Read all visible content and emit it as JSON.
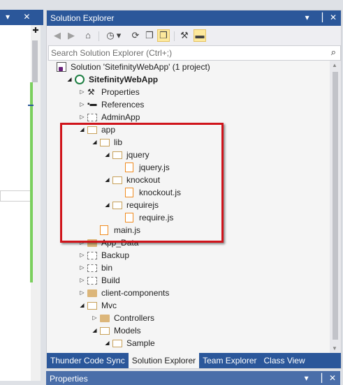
{
  "left_panel": {
    "title_glyphs": "▾ ✕",
    "pin_glyph": "✚"
  },
  "solution_explorer": {
    "title": "Solution Explorer",
    "title_buttons": {
      "dropdown": "▾",
      "pin": "▕",
      "close": "✕"
    },
    "toolbar": {
      "back": "◀",
      "forward": "▶",
      "home": "⌂",
      "history": "◷",
      "history_dropdown": "▾",
      "sync": "⟳",
      "collapse": "❐",
      "show_all": "❒",
      "properties": "⚒",
      "preview": "▬"
    },
    "search_placeholder": "Search Solution Explorer (Ctrl+;)",
    "search_icon": "⌕",
    "tree": [
      {
        "label": "Solution 'SitefinityWebApp' (1 project)",
        "depth": 0,
        "icon": "solution-icon",
        "arrow": ""
      },
      {
        "label": "SitefinityWebApp",
        "depth": 1,
        "icon": "web-project-icon",
        "arrow": "◢",
        "bold": true
      },
      {
        "label": "Properties",
        "depth": 2,
        "icon": "wrench-icon",
        "arrow": "▷"
      },
      {
        "label": "References",
        "depth": 2,
        "icon": "references-icon",
        "arrow": "▷"
      },
      {
        "label": "AdminApp",
        "depth": 2,
        "icon": "folder-dashed-icon",
        "arrow": "▷"
      },
      {
        "label": "app",
        "depth": 2,
        "icon": "folder-open-icon",
        "arrow": "◢"
      },
      {
        "label": "lib",
        "depth": 3,
        "icon": "folder-open-icon",
        "arrow": "◢"
      },
      {
        "label": "jquery",
        "depth": 4,
        "icon": "folder-open-icon",
        "arrow": "◢"
      },
      {
        "label": "jquery.js",
        "depth": 5,
        "icon": "js-file-icon",
        "arrow": ""
      },
      {
        "label": "knockout",
        "depth": 4,
        "icon": "folder-open-icon",
        "arrow": "◢"
      },
      {
        "label": "knockout.js",
        "depth": 5,
        "icon": "js-file-icon",
        "arrow": ""
      },
      {
        "label": "requirejs",
        "depth": 4,
        "icon": "folder-open-icon",
        "arrow": "◢"
      },
      {
        "label": "require.js",
        "depth": 5,
        "icon": "js-file-icon",
        "arrow": ""
      },
      {
        "label": "main.js",
        "depth": 3,
        "icon": "js-file-icon",
        "arrow": ""
      },
      {
        "label": "App_Data",
        "depth": 2,
        "icon": "folder-icon",
        "arrow": "▷"
      },
      {
        "label": "Backup",
        "depth": 2,
        "icon": "folder-dashed-icon",
        "arrow": "▷"
      },
      {
        "label": "bin",
        "depth": 2,
        "icon": "folder-dashed-icon",
        "arrow": "▷"
      },
      {
        "label": "Build",
        "depth": 2,
        "icon": "folder-dashed-icon",
        "arrow": "▷"
      },
      {
        "label": "client-components",
        "depth": 2,
        "icon": "folder-icon",
        "arrow": "▷"
      },
      {
        "label": "Mvc",
        "depth": 2,
        "icon": "folder-open-icon",
        "arrow": "◢"
      },
      {
        "label": "Controllers",
        "depth": 3,
        "icon": "folder-icon",
        "arrow": "▷"
      },
      {
        "label": "Models",
        "depth": 3,
        "icon": "folder-open-icon",
        "arrow": "◢"
      },
      {
        "label": "Sample",
        "depth": 4,
        "icon": "folder-open-icon",
        "arrow": "◢"
      }
    ],
    "tabs": [
      {
        "label": "Thunder Code Sync",
        "selected": false
      },
      {
        "label": "Solution Explorer",
        "selected": true
      },
      {
        "label": "Team Explorer",
        "selected": false
      },
      {
        "label": "Class View",
        "selected": false
      }
    ],
    "scroll_up": "▲",
    "scroll_down": "▼"
  },
  "properties_panel": {
    "title": "Properties",
    "buttons": {
      "dropdown": "▾",
      "pin": "▕",
      "close": "✕"
    }
  },
  "colors": {
    "title_blue": "#2b579a",
    "highlight_red": "#d0141b",
    "js_orange": "#f08c20",
    "folder_tan": "#dcb67a"
  }
}
